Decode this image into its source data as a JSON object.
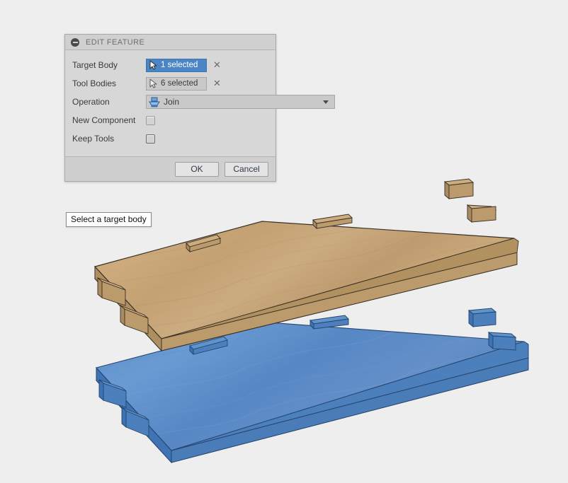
{
  "app": {
    "background_color": "#eeeeee"
  },
  "dialog": {
    "title": "EDIT FEATURE",
    "collapse_icon": "minus-circle-icon",
    "rows": {
      "target_body": {
        "label": "Target Body",
        "chip_text": "1 selected",
        "chip_state": "active",
        "chip_color": "#4a86c5",
        "cursor_icon": "selection-cursor-icon",
        "clear_icon": "close-x-icon",
        "clear_label": "✕"
      },
      "tool_bodies": {
        "label": "Tool Bodies",
        "chip_text": "6 selected",
        "chip_state": "inactive",
        "chip_color": "#c9c9c9",
        "cursor_icon": "selection-cursor-icon",
        "clear_icon": "close-x-icon",
        "clear_label": "✕"
      },
      "operation": {
        "label": "Operation",
        "value": "Join",
        "icon": "join-operation-icon",
        "arrow_icon": "chevron-down-icon"
      },
      "new_component": {
        "label": "New Component",
        "checked": false
      },
      "keep_tools": {
        "label": "Keep Tools",
        "checked": false
      }
    },
    "footer": {
      "ok_label": "OK",
      "cancel_label": "Cancel"
    }
  },
  "tooltip": {
    "text": "Select a target body"
  },
  "viewport": {
    "wood_body": {
      "name": "wood-board-body",
      "top_color": "#c6a477",
      "side_color": "#a98b5f",
      "edge_color": "#3a3026"
    },
    "blue_body": {
      "name": "blue-board-body",
      "top_color": "#5b8fc9",
      "side_color": "#3f73b4",
      "edge_color": "#27456e"
    }
  }
}
